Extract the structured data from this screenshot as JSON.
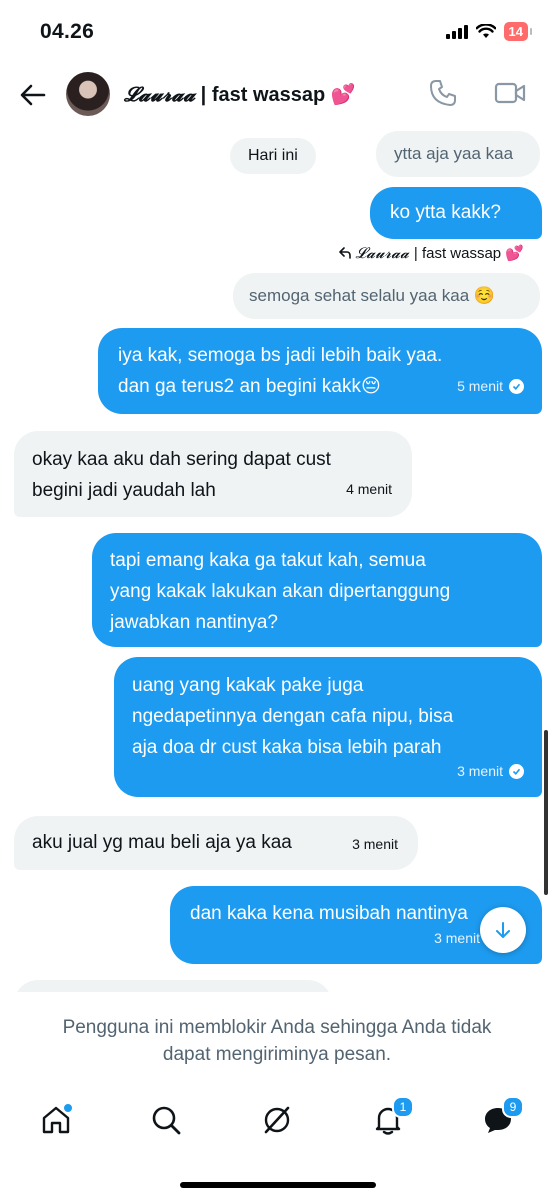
{
  "status_bar": {
    "time": "04.26",
    "battery": "14"
  },
  "header": {
    "name_styled": "𝓛𝓪𝓾𝓻𝓪𝓪",
    "name_rest": " | fast wassap 💕"
  },
  "date_separator": "Hari ini",
  "messages": [
    {
      "side": "in",
      "text": "ytta aja yaa kaa",
      "time": ""
    },
    {
      "side": "out",
      "text": "ko ytta kakk?",
      "time": ""
    },
    {
      "side": "in",
      "text": "semoga sehat selalu yaa kaa ☺️",
      "time": ""
    },
    {
      "side": "out",
      "line1": "iya kak, semoga bs jadi lebih baik yaa.",
      "line2": "dan ga terus2 an begini kakk😔",
      "time": "5 menit"
    },
    {
      "side": "in",
      "line1": "okay kaa aku dah sering dapat cust",
      "line2": "begini jadi yaudah lah",
      "time": "4 menit"
    },
    {
      "side": "out",
      "line1": "tapi emang kaka ga takut kah, semua",
      "line2": "yang kakak lakukan akan dipertanggung",
      "line3": "jawabkan nantinya?",
      "time": ""
    },
    {
      "side": "out",
      "line1": "uang yang kakak pake juga",
      "line2": "ngedapetinnya dengan cafa nipu, bisa",
      "line3": "aja doa dr cust kaka bisa lebih parah",
      "time": "3 menit"
    },
    {
      "side": "in",
      "text": "aku jual yg mau beli aja ya kaa",
      "time": "3 menit"
    },
    {
      "side": "out",
      "text": "dan kaka kena musibah nantinya",
      "time": "3 menit"
    }
  ],
  "reply_context": {
    "name_styled": "𝓛𝓪𝓾𝓻𝓪𝓪",
    "name_rest": " | fast wassap 💕"
  },
  "blocked_notice": "Pengguna ini memblokir Anda sehingga Anda tidak dapat mengiriminya pesan.",
  "tabs": [
    {
      "name": "home",
      "badge": ""
    },
    {
      "name": "search",
      "badge": ""
    },
    {
      "name": "grok",
      "badge": ""
    },
    {
      "name": "notifications",
      "badge": "1"
    },
    {
      "name": "messages",
      "badge": "9"
    }
  ]
}
